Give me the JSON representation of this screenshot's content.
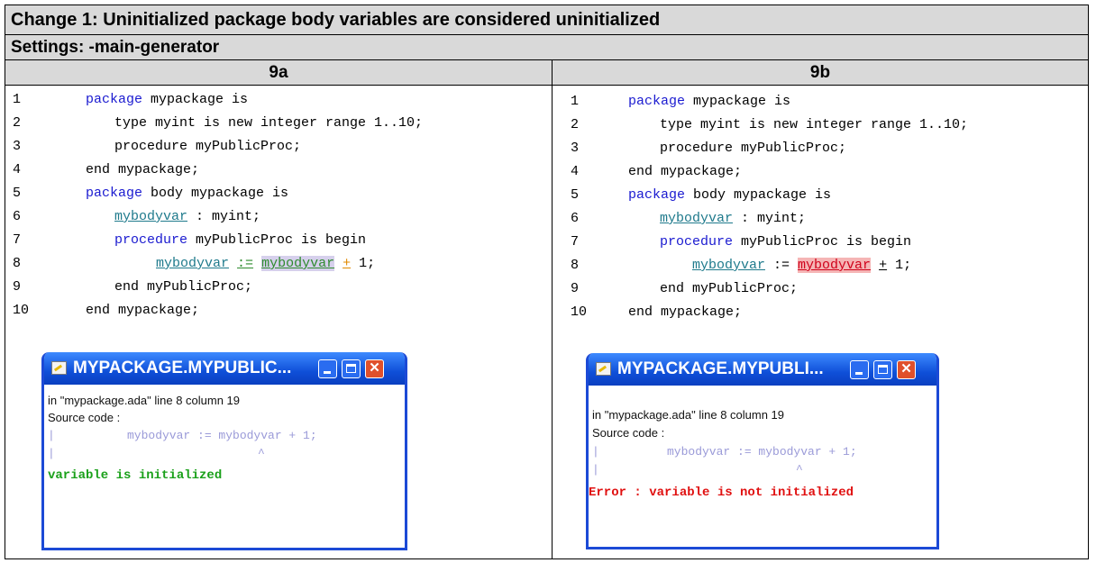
{
  "title": "Change 1: Uninitialized package body variables are considered uninitialized",
  "settings": "Settings: -main-generator",
  "col_a": {
    "header": "9a",
    "lines": {
      "n1": "1",
      "n2": "2",
      "n3": "3",
      "n4": "4",
      "n5": "5",
      "n6": "6",
      "n7": "7",
      "n8": "8",
      "n9": "9",
      "n10": "10"
    },
    "code": {
      "l1_kw": "package",
      "l1_rest": " mypackage is",
      "l2": "type myint is new integer range 1..10;",
      "l3": "procedure myPublicProc;",
      "l4": "end mypackage;",
      "l5_kw": "package",
      "l5_rest": " body mypackage is",
      "l6_var": "mybodyvar",
      "l6_rest": " : myint;",
      "l7_kw": "procedure",
      "l7_rest": " myPublicProc is begin",
      "l8_var1": "mybodyvar",
      "l8_assign": ":=",
      "l8_var2": "mybodyvar",
      "l8_plus": "+",
      "l8_rest": " 1;",
      "l9": "end myPublicProc;",
      "l10": "end mypackage;"
    },
    "popup": {
      "title": "MYPACKAGE.MYPUBLIC...",
      "location": "in \"mypackage.ada\" line 8 column 19",
      "source_label": "Source code :",
      "pipe1": "|",
      "source_line": "mybodyvar := mybodyvar + 1;",
      "pipe2": "|",
      "caret": "^",
      "message": "variable is initialized"
    }
  },
  "col_b": {
    "header": "9b",
    "lines": {
      "n1": "1",
      "n2": "2",
      "n3": "3",
      "n4": "4",
      "n5": "5",
      "n6": "6",
      "n7": "7",
      "n8": "8",
      "n9": "9",
      "n10": "10"
    },
    "code": {
      "l1_kw": "package",
      "l1_rest": " mypackage is",
      "l2": "type myint is new integer range 1..10;",
      "l3": "procedure myPublicProc;",
      "l4": "end mypackage;",
      "l5_kw": "package",
      "l5_rest": " body mypackage is",
      "l6_var": "mybodyvar",
      "l6_rest": " : myint;",
      "l7_kw": "procedure",
      "l7_rest": " myPublicProc is begin",
      "l8_var1": "mybodyvar",
      "l8_assign": " := ",
      "l8_var2": "mybodyvar",
      "l8_plus": "+",
      "l8_rest": " 1;",
      "l9": "end myPublicProc;",
      "l10": "end mypackage;"
    },
    "popup": {
      "title": "MYPACKAGE.MYPUBLI...",
      "location": "in \"mypackage.ada\" line 8 column 19",
      "source_label": "Source code :",
      "pipe1": "|",
      "source_line": "mybodyvar := mybodyvar + 1;",
      "pipe2": "|",
      "caret": "^",
      "message": "Error : variable is not initialized"
    }
  },
  "colors": {
    "keyword": "#1a1ad0",
    "ok": "#1aa01a",
    "error": "#e01010",
    "window_title": "#0f4fd8"
  }
}
